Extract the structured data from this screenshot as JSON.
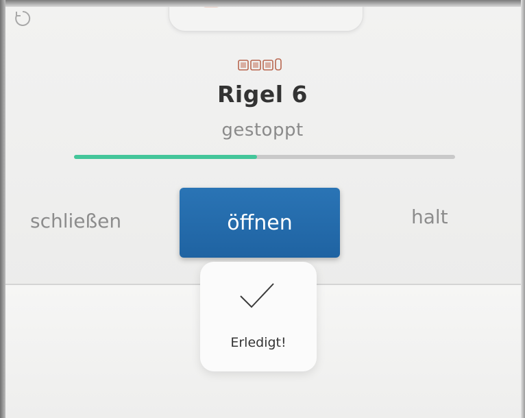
{
  "device": {
    "icon": "shutter-device-icon",
    "name": "Rigel 6",
    "status": "gestoppt",
    "position_fraction": 0.48
  },
  "controls": {
    "close_label": "schließen",
    "open_label": "öffnen",
    "stop_label": "halt"
  },
  "toast": {
    "icon": "checkmark-icon",
    "message": "Erledigt!"
  },
  "top_bar": {
    "refresh_icon": "refresh-icon"
  },
  "colors": {
    "accent_blue": "#2168a9",
    "progress_green": "#44c69a"
  }
}
